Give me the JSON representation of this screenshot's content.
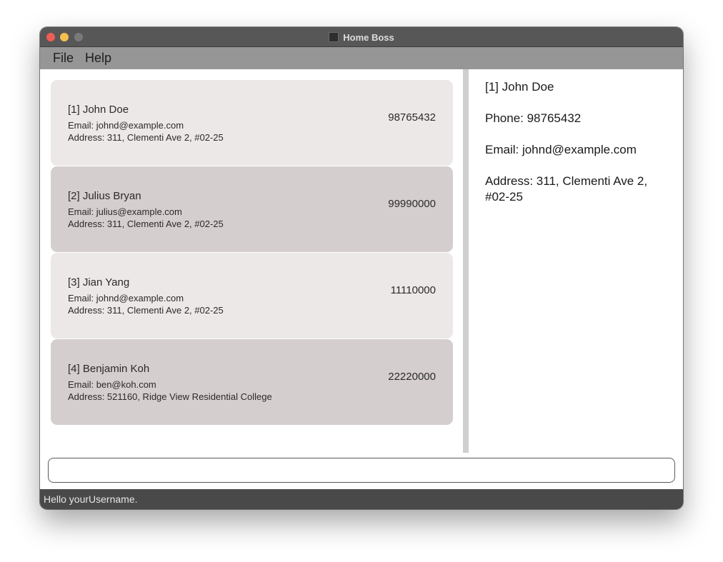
{
  "window": {
    "title": "Home Boss"
  },
  "menu": {
    "file": "File",
    "help": "Help"
  },
  "persons": [
    {
      "name": "[1] John Doe",
      "email": "Email: johnd@example.com",
      "address": "Address: 311, Clementi Ave 2, #02-25",
      "phone": "98765432"
    },
    {
      "name": "[2] Julius Bryan",
      "email": "Email: julius@example.com",
      "address": "Address: 311, Clementi Ave 2, #02-25",
      "phone": "99990000"
    },
    {
      "name": "[3] Jian Yang",
      "email": "Email: johnd@example.com",
      "address": "Address: 311, Clementi Ave 2, #02-25",
      "phone": "11110000"
    },
    {
      "name": "[4] Benjamin Koh",
      "email": "Email: ben@koh.com",
      "address": "Address: 521160, Ridge View Residential College",
      "phone": "22220000"
    }
  ],
  "detail": {
    "name": "[1] John Doe",
    "phone": "Phone: 98765432",
    "email": "Email: johnd@example.com",
    "address": "Address: 311, Clementi Ave 2, #02-25"
  },
  "command": {
    "value": ""
  },
  "status": {
    "message": "Hello yourUsername."
  }
}
